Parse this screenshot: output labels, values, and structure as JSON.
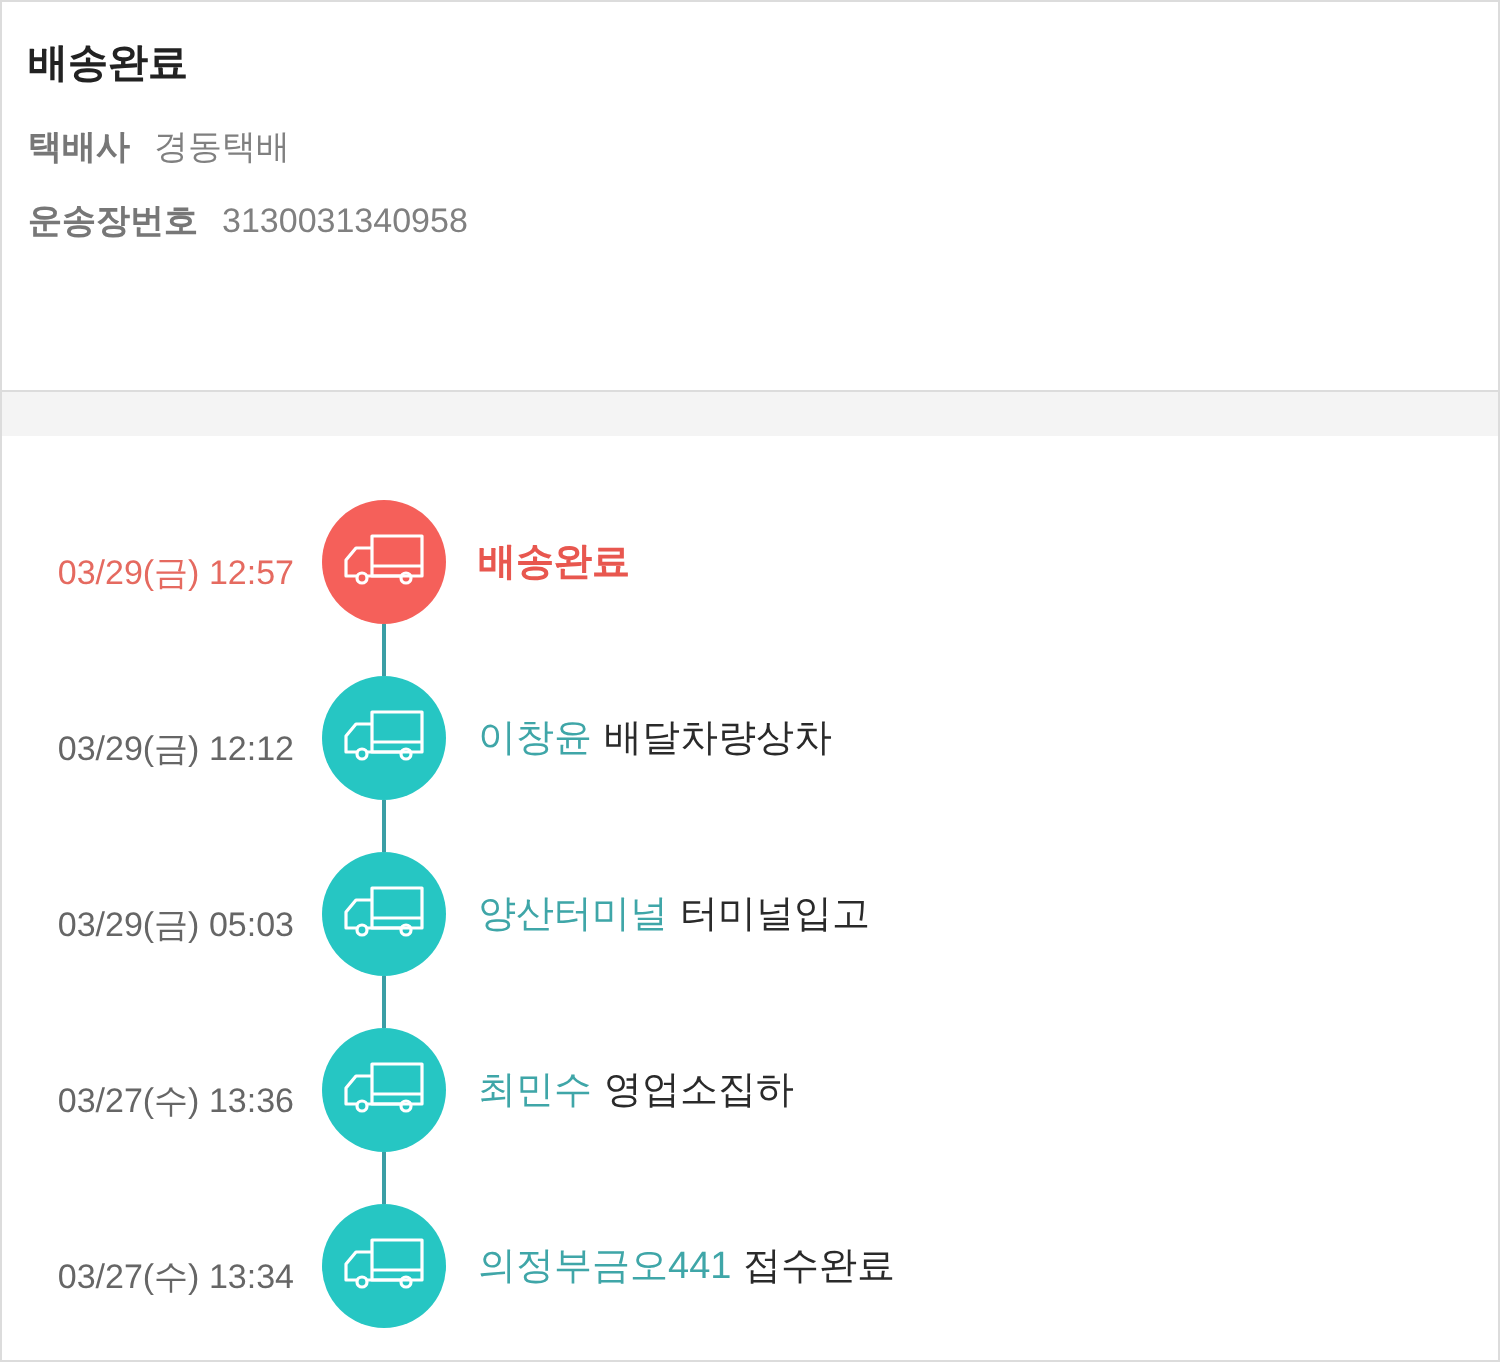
{
  "header": {
    "title": "배송완료",
    "fields": [
      {
        "label": "택배사",
        "value": "경동택배"
      },
      {
        "label": "운송장번호",
        "value": "3130031340958"
      }
    ]
  },
  "timeline": [
    {
      "time": "03/29(금) 12:57",
      "status": "배송완료",
      "current": true
    },
    {
      "time": "03/29(금) 12:12",
      "location": "이창윤",
      "status": "배달차량상차",
      "current": false
    },
    {
      "time": "03/29(금) 05:03",
      "location": "양산터미널",
      "status": "터미널입고",
      "current": false
    },
    {
      "time": "03/27(수) 13:36",
      "location": "최민수",
      "status": "영업소집하",
      "current": false
    },
    {
      "time": "03/27(수) 13:34",
      "location": "의정부금오441",
      "status": "접수완료",
      "current": false
    }
  ]
}
